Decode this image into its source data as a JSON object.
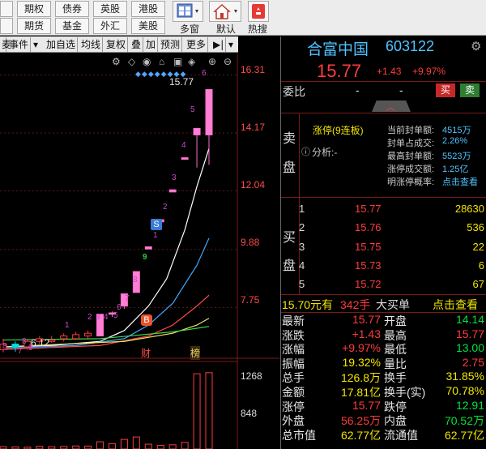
{
  "toolbar": {
    "row1": [
      "期权",
      "债券",
      "英股",
      "港股"
    ],
    "row2": [
      "期货",
      "基金",
      "外汇",
      "美股"
    ],
    "tools": [
      {
        "label": "多窗",
        "icon": "multi-window-icon"
      },
      {
        "label": "默认",
        "icon": "home-icon"
      },
      {
        "label": "热搜",
        "icon": "hot-search-icon"
      }
    ]
  },
  "chartbar": {
    "items": [
      "事件",
      "加自选",
      "均线",
      "复权",
      "叠",
      "加",
      "预测",
      "更多"
    ]
  },
  "chart": {
    "price_ticks": [
      "16.31",
      "14.17",
      "12.04",
      "9.88",
      "7.75"
    ],
    "volume_ticks": [
      "1268",
      "848"
    ],
    "high_label": "15.77",
    "low_label": "6.12",
    "day_numbers": [
      "1",
      "2",
      "3",
      "4",
      "5",
      "6",
      "7",
      "8",
      "9",
      "1",
      "2",
      "3",
      "4",
      "5",
      "6"
    ],
    "left_numbers": [
      "8",
      "7",
      "8",
      "9"
    ],
    "markers": {
      "buy": "B",
      "sell": "S",
      "cai": "财",
      "bang": "榜"
    }
  },
  "chart_data": {
    "type": "candlestick",
    "ylim": [
      6.0,
      16.5
    ],
    "candles": [
      {
        "o": 6.2,
        "c": 6.4,
        "h": 6.6,
        "l": 6.1
      },
      {
        "o": 6.4,
        "c": 6.3,
        "h": 6.5,
        "l": 6.12
      },
      {
        "o": 6.3,
        "c": 6.5,
        "h": 6.6,
        "l": 6.2
      },
      {
        "o": 6.5,
        "c": 6.6,
        "h": 6.7,
        "l": 6.4
      },
      {
        "o": 6.5,
        "c": 6.55,
        "h": 6.7,
        "l": 6.45
      },
      {
        "o": 6.6,
        "c": 6.7,
        "h": 6.8,
        "l": 6.5
      },
      {
        "o": 6.6,
        "c": 6.75,
        "h": 6.85,
        "l": 6.55
      },
      {
        "o": 6.7,
        "c": 6.8,
        "h": 6.9,
        "l": 6.6
      },
      {
        "o": 6.7,
        "c": 7.5,
        "h": 7.5,
        "l": 6.7
      },
      {
        "o": 7.5,
        "c": 7.55,
        "h": 7.6,
        "l": 7.4
      },
      {
        "o": 7.8,
        "c": 8.25,
        "h": 8.25,
        "l": 7.7
      },
      {
        "o": 8.3,
        "c": 9.07,
        "h": 9.07,
        "l": 8.3
      },
      {
        "o": 9.9,
        "c": 9.98,
        "h": 10.0,
        "l": 9.9
      },
      {
        "o": 10.9,
        "c": 10.98,
        "h": 10.98,
        "l": 10.9
      },
      {
        "o": 12.0,
        "c": 12.08,
        "h": 12.08,
        "l": 12.0
      },
      {
        "o": 13.2,
        "c": 13.26,
        "h": 13.26,
        "l": 13.2
      },
      {
        "o": 14.1,
        "c": 14.34,
        "h": 14.36,
        "l": 12.9
      },
      {
        "o": 14.1,
        "c": 15.77,
        "h": 15.77,
        "l": 13.0
      }
    ],
    "volume_ylim": [
      0,
      1400
    ],
    "volumes": [
      40,
      35,
      30,
      45,
      38,
      42,
      50,
      48,
      120,
      90,
      160,
      200,
      80,
      60,
      70,
      110,
      1250,
      1268
    ]
  },
  "panel": {
    "name": "合富中国",
    "code": "603122",
    "price": "15.77",
    "change": "+1.43",
    "pct": "+9.97%",
    "weibi_label": "委比",
    "weibi_val": "-",
    "weibi_val2": "-",
    "buy_btn": "买",
    "sell_btn": "卖",
    "sell_label_1": "卖",
    "sell_label_2": "盘",
    "limit_text": "涨停(9连板)",
    "analysis_text": "分析:-",
    "seal_rows": [
      {
        "k": "当前封单额:",
        "v": "4515万"
      },
      {
        "k": "封单占成交:",
        "v": "2.26%"
      },
      {
        "k": "最高封单额:",
        "v": "5523万"
      },
      {
        "k": "涨停成交额:",
        "v": "1.25亿"
      },
      {
        "k": "明涨停概率:",
        "v": "点击查看"
      }
    ],
    "buy_label_1": "买",
    "buy_label_2": "盘",
    "bids": [
      {
        "lvl": "1",
        "p": "15.77",
        "v": "28630"
      },
      {
        "lvl": "2",
        "p": "15.76",
        "v": "536"
      },
      {
        "lvl": "3",
        "p": "15.75",
        "v": "22"
      },
      {
        "lvl": "4",
        "p": "15.73",
        "v": "6"
      },
      {
        "lvl": "5",
        "p": "15.72",
        "v": "67"
      }
    ],
    "bigbuy": {
      "price": "15.70元有",
      "qty": "342手",
      "label": "大买单",
      "link": "点击查看"
    },
    "stats": [
      {
        "k1": "最新",
        "v1": "15.77",
        "c1": "red",
        "k2": "开盘",
        "v2": "14.14",
        "c2": "green"
      },
      {
        "k1": "涨跌",
        "v1": "+1.43",
        "c1": "red",
        "k2": "最高",
        "v2": "15.77",
        "c2": "red"
      },
      {
        "k1": "涨幅",
        "v1": "+9.97%",
        "c1": "red",
        "k2": "最低",
        "v2": "13.00",
        "c2": "green"
      },
      {
        "k1": "振幅",
        "v1": "19.32%",
        "c1": "yellow",
        "k2": "量比",
        "v2": "2.75",
        "c2": "red"
      },
      {
        "k1": "总手",
        "v1": "126.8万",
        "c1": "yellow",
        "k2": "换手",
        "v2": "31.85%",
        "c2": "yellow"
      },
      {
        "k1": "金额",
        "v1": "17.81亿",
        "c1": "yellow",
        "k2": "换手(实)",
        "v2": "70.78%",
        "c2": "yellow"
      },
      {
        "k1": "涨停",
        "v1": "15.77",
        "c1": "red",
        "k2": "跌停",
        "v2": "12.91",
        "c2": "green"
      },
      {
        "k1": "外盘",
        "v1": "56.25万",
        "c1": "red",
        "k2": "内盘",
        "v2": "70.52万",
        "c2": "green"
      },
      {
        "k1": "总市值",
        "v1": "62.77亿",
        "c1": "yellow",
        "k2": "流通值",
        "v2": "62.77亿",
        "c2": "yellow"
      }
    ]
  }
}
